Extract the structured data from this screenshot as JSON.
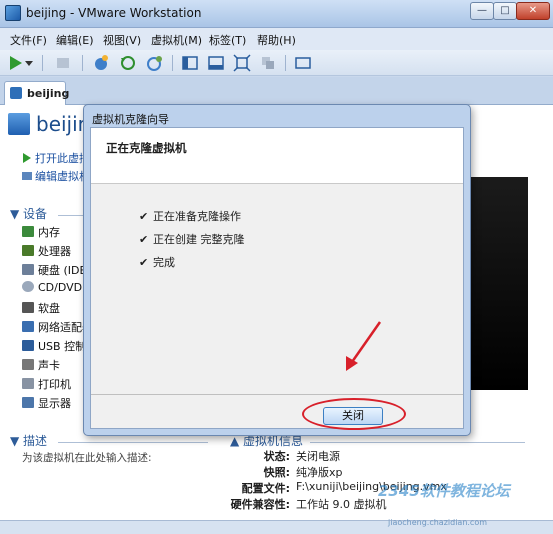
{
  "window": {
    "title": "beijing - VMware Workstation",
    "minimize": "—",
    "maximize": "□",
    "close": "✕"
  },
  "menu": [
    "文件(F)",
    "编辑(E)",
    "视图(V)",
    "虚拟机(M)",
    "标签(T)",
    "帮助(H)"
  ],
  "tab": {
    "label": "beijing"
  },
  "vm": {
    "name": "beijing"
  },
  "actions": {
    "power_on": "打开此虚拟机",
    "edit": "编辑虚拟机设置"
  },
  "devices": {
    "header": "设备",
    "items": [
      "内存",
      "处理器",
      "硬盘 (IDE)",
      "CD/DVD",
      "软盘",
      "网络适配器",
      "USB 控制器",
      "声卡",
      "打印机",
      "显示器"
    ]
  },
  "description": {
    "header": "描述",
    "hint": "为该虚拟机在此处输入描述:"
  },
  "vm_details": {
    "header": "虚拟机信息",
    "rows": [
      {
        "label": "状态:",
        "value": "关闭电源"
      },
      {
        "label": "快照:",
        "value": "纯净版xp"
      },
      {
        "label": "配置文件:",
        "value": "F:\\xuniji\\beijing\\beijing.vmx"
      },
      {
        "label": "硬件兼容性:",
        "value": "工作站 9.0 虚拟机"
      }
    ]
  },
  "dialog": {
    "title": "虚拟机克隆向导",
    "heading": "正在克隆虚拟机",
    "steps": [
      "正在准备克隆操作",
      "正在创建 完整克隆",
      "完成"
    ],
    "close_label": "关闭"
  },
  "watermark": {
    "text": "2345软件教程论坛",
    "sub": "jiaocheng.chazidian.com"
  },
  "colors": {
    "accent": "#1c4d8c",
    "annotation": "#d8202a"
  }
}
